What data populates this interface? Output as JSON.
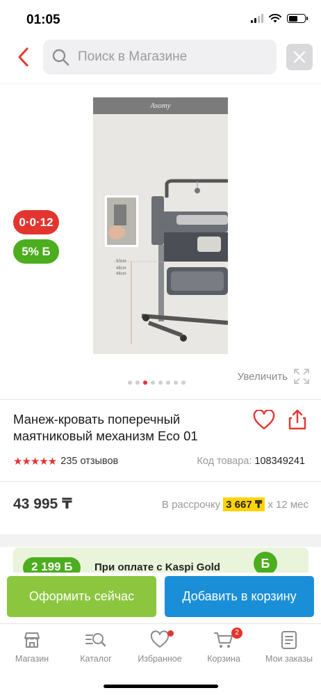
{
  "status": {
    "time": "01:05"
  },
  "search": {
    "placeholder": "Поиск в Магазине"
  },
  "product": {
    "brand_on_image": "Asomy",
    "image_scale_labels": [
      "50cm",
      "48cm",
      "46cm"
    ],
    "title": "Манеж-кровать поперечный маятниковый механизм Eco 01",
    "rating_stars": 5,
    "reviews": "235 отзывов",
    "code_label": "Код товара:",
    "code_value": "108349241",
    "price": "43 995 ₸",
    "installment_label": "В рассрочку",
    "installment_amount": "3 667 ₸",
    "installment_term": "x 12 мес"
  },
  "badges": {
    "installment": "0·0·12",
    "bonus": "5% Б"
  },
  "gallery": {
    "zoom_label": "Увеличить",
    "dots_count": 8,
    "active_index": 2
  },
  "promo": {
    "amount": "2 199 Б",
    "text": "При оплате с Kaspi Gold",
    "coin": "Б"
  },
  "actions": {
    "buy_now": "Оформить сейчас",
    "add_to_cart": "Добавить в корзину"
  },
  "tabbar": {
    "items": [
      {
        "label": "Магазин",
        "icon": "store-icon"
      },
      {
        "label": "Каталог",
        "icon": "catalog-search-icon"
      },
      {
        "label": "Избранное",
        "icon": "heart-icon"
      },
      {
        "label": "Корзина",
        "icon": "cart-icon",
        "badge": "2"
      },
      {
        "label": "Мои заказы",
        "icon": "orders-icon"
      }
    ]
  },
  "colors": {
    "accent_red": "#e3352f",
    "green": "#4cad1e",
    "light_green": "#8cc63f",
    "blue": "#1a8fd8",
    "highlight_yellow": "#ffd400"
  }
}
